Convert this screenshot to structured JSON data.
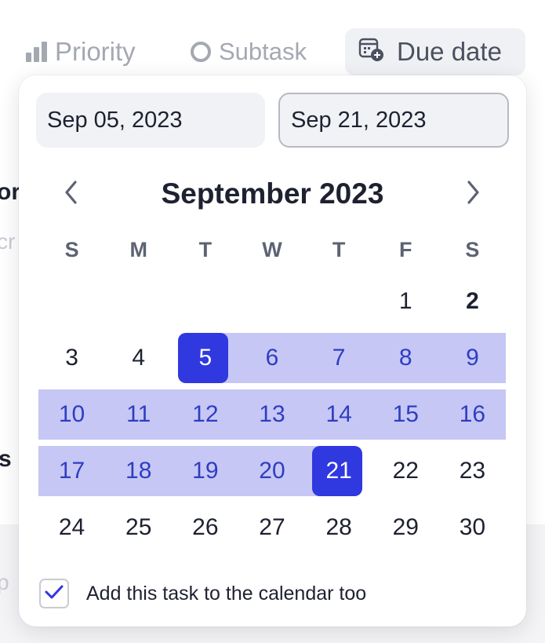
{
  "toolbar": {
    "priority_label": "Priority",
    "subtask_label": "Subtask",
    "due_date_label": "Due date"
  },
  "background_fragments": {
    "a": "or",
    "b": "cr",
    "c": "s",
    "d": "p"
  },
  "date_picker": {
    "start_date": "Sep 05, 2023",
    "end_date": "Sep 21, 2023",
    "month_title": "September 2023",
    "weekdays": [
      "S",
      "M",
      "T",
      "W",
      "T",
      "F",
      "S"
    ],
    "days": [
      {
        "label": "",
        "state": "blank"
      },
      {
        "label": "",
        "state": "blank"
      },
      {
        "label": "",
        "state": "blank"
      },
      {
        "label": "",
        "state": "blank"
      },
      {
        "label": "",
        "state": "blank"
      },
      {
        "label": "1",
        "state": "normal"
      },
      {
        "label": "2",
        "state": "today"
      },
      {
        "label": "3",
        "state": "normal"
      },
      {
        "label": "4",
        "state": "normal"
      },
      {
        "label": "5",
        "state": "start"
      },
      {
        "label": "6",
        "state": "range"
      },
      {
        "label": "7",
        "state": "range"
      },
      {
        "label": "8",
        "state": "range"
      },
      {
        "label": "9",
        "state": "range"
      },
      {
        "label": "10",
        "state": "range"
      },
      {
        "label": "11",
        "state": "range"
      },
      {
        "label": "12",
        "state": "range"
      },
      {
        "label": "13",
        "state": "range"
      },
      {
        "label": "14",
        "state": "range"
      },
      {
        "label": "15",
        "state": "range"
      },
      {
        "label": "16",
        "state": "range"
      },
      {
        "label": "17",
        "state": "range"
      },
      {
        "label": "18",
        "state": "range"
      },
      {
        "label": "19",
        "state": "range"
      },
      {
        "label": "20",
        "state": "range"
      },
      {
        "label": "21",
        "state": "end"
      },
      {
        "label": "22",
        "state": "normal"
      },
      {
        "label": "23",
        "state": "normal"
      },
      {
        "label": "24",
        "state": "normal"
      },
      {
        "label": "25",
        "state": "normal"
      },
      {
        "label": "26",
        "state": "normal"
      },
      {
        "label": "27",
        "state": "normal"
      },
      {
        "label": "28",
        "state": "normal"
      },
      {
        "label": "29",
        "state": "normal"
      },
      {
        "label": "30",
        "state": "normal"
      }
    ],
    "add_to_calendar_label": "Add this task to the calendar too",
    "add_to_calendar_checked": true
  },
  "colors": {
    "accent": "#3038e0",
    "range_fill": "#c6c7f5",
    "range_text": "#2f3ec0",
    "text": "#1e2130",
    "muted": "#a4a8b1"
  }
}
